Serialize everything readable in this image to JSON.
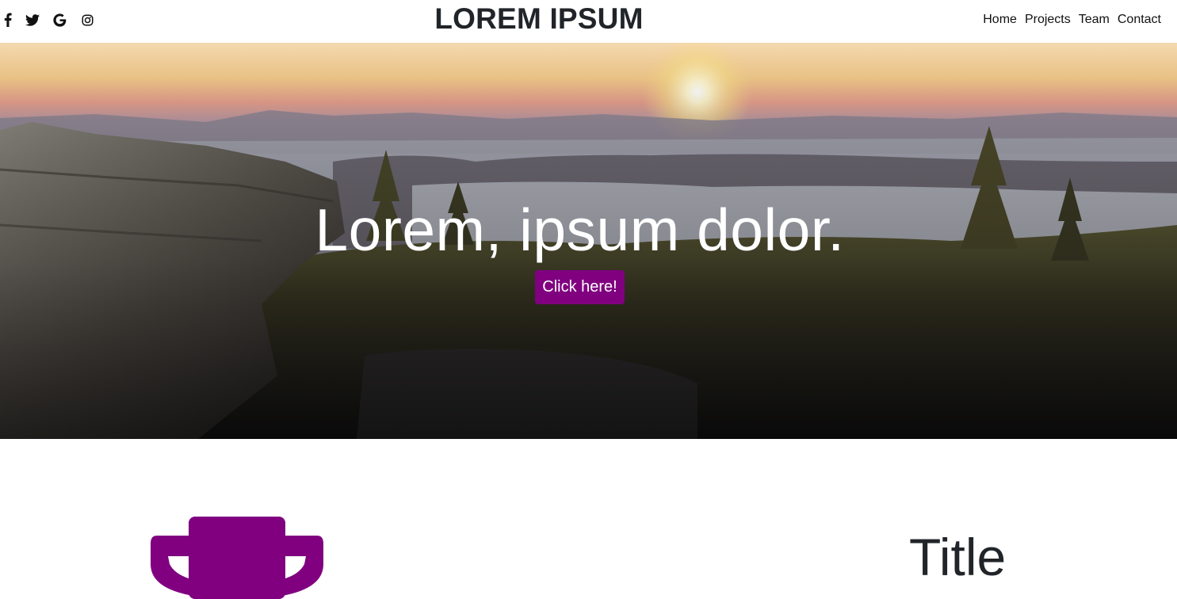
{
  "header": {
    "brand": "LOREM IPSUM",
    "social": [
      {
        "icon": "facebook-icon"
      },
      {
        "icon": "twitter-icon"
      },
      {
        "icon": "google-icon"
      },
      {
        "icon": "instagram-icon"
      }
    ],
    "nav": [
      "Home",
      "Projects",
      "Team",
      "Contact"
    ]
  },
  "hero": {
    "title": "Lorem, ipsum dolor.",
    "button_label": "Click here!"
  },
  "feature": {
    "icon": "trophy-icon",
    "title": "Title"
  },
  "colors": {
    "accent": "#800080",
    "text": "#212529",
    "background": "#ffffff"
  }
}
